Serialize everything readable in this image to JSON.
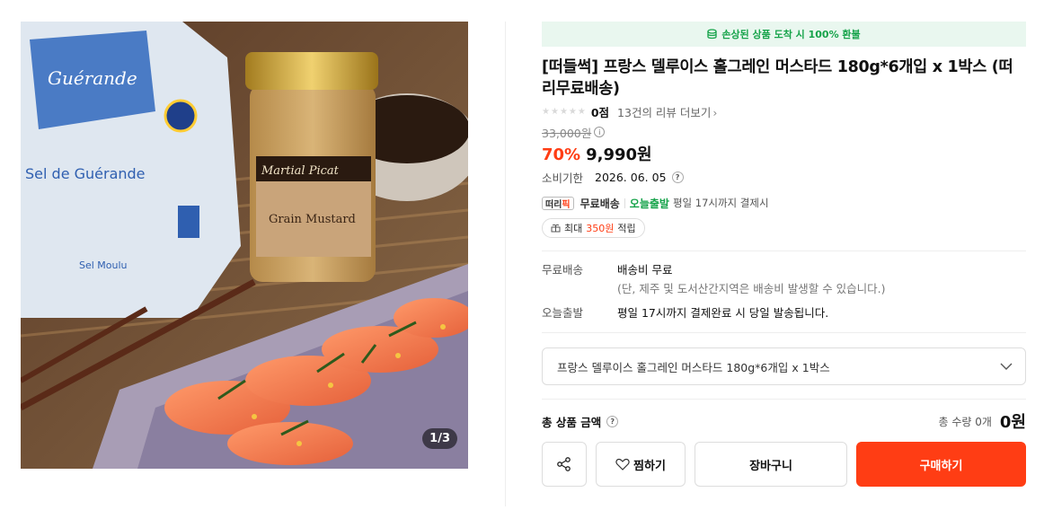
{
  "image": {
    "counter": "1/3"
  },
  "banner": {
    "text": "손상된 상품 도착 시 100% 환불"
  },
  "product": {
    "title": "[떠들썩] 프랑스 델루이스 홀그레인 머스타드 180g*6개입 x 1박스 (떠리무료배송)",
    "score": "0점",
    "review_link": "13건의 리뷰 더보기",
    "original_price": "33,000원",
    "discount": "70%",
    "price": "9,990원",
    "expiry_label": "소비기한",
    "expiry_value": "2026. 06. 05"
  },
  "delivery": {
    "logo": "떠리",
    "logo_accent": "픽",
    "free_shipping": "무료배송",
    "today_ship": "오늘출발",
    "today_note": "평일 17시까지 결제시",
    "points_prefix": "최대",
    "points_amount": "350원",
    "points_suffix": "적립"
  },
  "shipping_info": {
    "free_label": "무료배송",
    "free_value": "배송비 무료",
    "free_note": "(단, 제주 및 도서산간지역은 배송비 발생할 수 있습니다.)",
    "today_label": "오늘출발",
    "today_value": "평일 17시까지 결제완료 시 당일 발송됩니다."
  },
  "option": {
    "selected": "프랑스 델루이스 홀그레인 머스타드 180g*6개입 x 1박스"
  },
  "total": {
    "label": "총 상품 금액",
    "qty": "총 수량 0개",
    "price": "0원"
  },
  "actions": {
    "wish": "찜하기",
    "cart": "장바구니",
    "buy": "구매하기"
  },
  "colors": {
    "accent": "#ff3d14",
    "green": "#16a34a"
  },
  "icons": [
    "coin-icon",
    "star-icon",
    "info-icon",
    "question-icon",
    "gift-icon",
    "chevron-down-icon",
    "share-icon",
    "heart-icon"
  ]
}
